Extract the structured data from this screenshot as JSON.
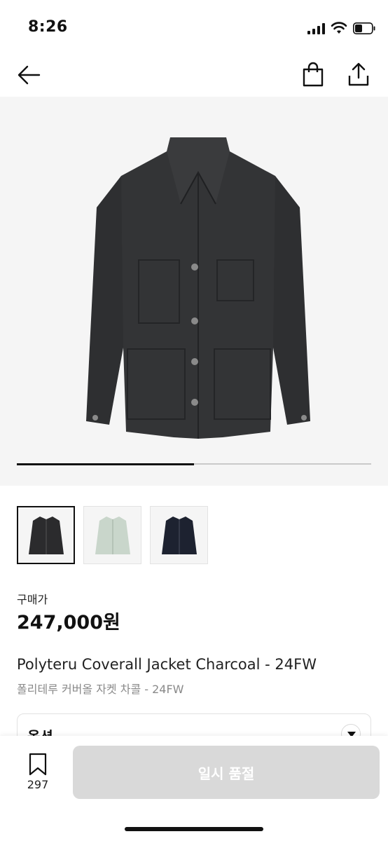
{
  "status_bar": {
    "time": "8:26"
  },
  "hero": {
    "image_index": 1,
    "image_count": 2,
    "progress": 0.5
  },
  "thumbnails": [
    {
      "name": "charcoal",
      "color": "#2b2b2d"
    },
    {
      "name": "mint",
      "color": "#c9d6cb"
    },
    {
      "name": "navy",
      "color": "#1d2230"
    }
  ],
  "price": {
    "label": "구매가",
    "value": "247,000원"
  },
  "product": {
    "title_en": "Polyteru Coverall Jacket Charcoal - 24FW",
    "title_ko": "폴리테루 커버올 자켓 차콜 - 24FW"
  },
  "options": {
    "label": "옵션"
  },
  "bottom_bar": {
    "bookmark_count": "297",
    "soldout_label": "일시 품절"
  },
  "colors": {
    "soldout_button": "#d9d9d9",
    "hero_bg": "#f5f5f5",
    "jacket": "#2e2f31"
  },
  "icons": {
    "back": "arrow-left-icon",
    "bag": "shopping-bag-icon",
    "share": "share-icon",
    "bookmark": "bookmark-icon",
    "option_toggle": "chevron-down-icon"
  }
}
